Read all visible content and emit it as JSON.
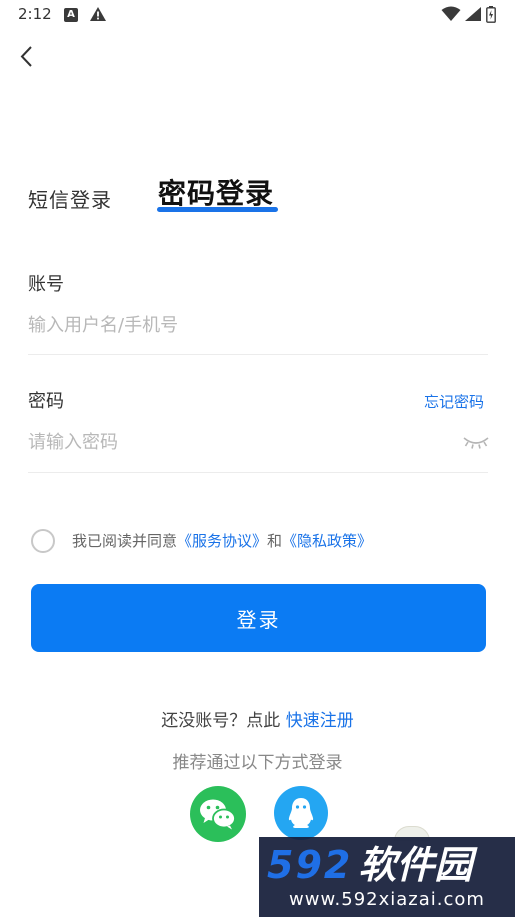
{
  "status_bar": {
    "time": "2:12",
    "a_glyph": "A",
    "icons": [
      "a-box-icon",
      "warning-icon",
      "wifi-icon",
      "signal-icon",
      "battery-icon"
    ]
  },
  "nav": {
    "back_icon": "chevron-left-icon"
  },
  "tabs": {
    "sms_label": "短信登录",
    "password_label": "密码登录",
    "active": "password"
  },
  "account": {
    "label": "账号",
    "placeholder": "输入用户名/手机号",
    "value": ""
  },
  "password": {
    "label": "密码",
    "placeholder": "请输入密码",
    "value": "",
    "forgot_label": "忘记密码",
    "toggle_icon": "eye-closed-icon"
  },
  "agreement": {
    "prefix": "我已阅读并同意",
    "service_link": "《服务协议》",
    "and": "和",
    "privacy_link": "《隐私政策》",
    "checked": false
  },
  "login_button_label": "登录",
  "register": {
    "prompt": "还没账号？点此",
    "link": "快速注册"
  },
  "alt_login_text": "推荐通过以下方式登录",
  "social": [
    {
      "name": "wechat",
      "icon": "wechat-icon",
      "color": "#2bbf5a"
    },
    {
      "name": "qq",
      "icon": "qq-penguin-icon",
      "color": "#24a6f2"
    }
  ],
  "watermark": {
    "number": "592",
    "name": "软件园",
    "url": "www.592xiazai.com"
  },
  "colors": {
    "accent": "#1a73e8",
    "button": "#0b7bf3",
    "placeholder": "#b8b8b8"
  }
}
